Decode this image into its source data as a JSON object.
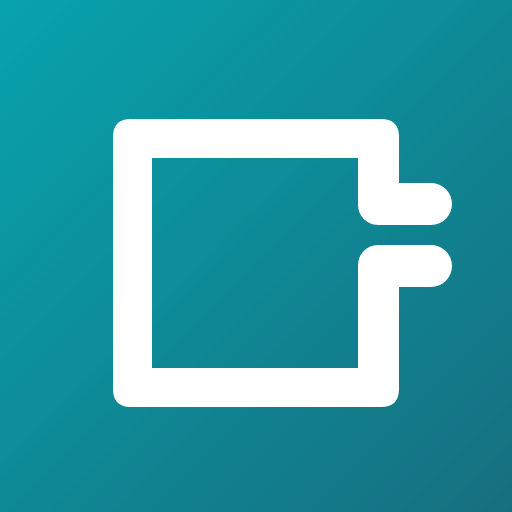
{
  "icon": {
    "name": "wallet-logo-icon",
    "colors": {
      "background_top_left": "#07a3ad",
      "background_bottom_right": "#166f7f",
      "glyph": "#ffffff"
    }
  }
}
